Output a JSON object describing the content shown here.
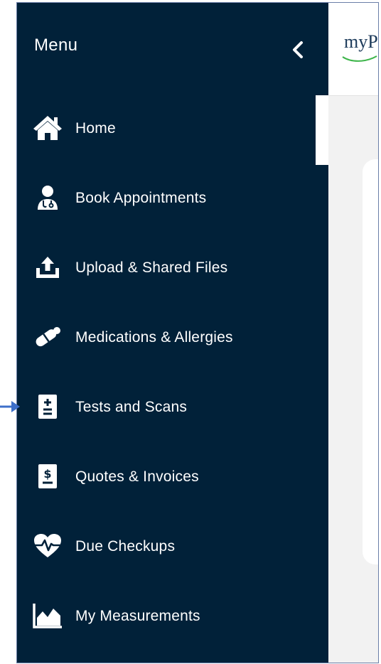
{
  "sidebar": {
    "title": "Menu",
    "collapse_icon": "chevron-left-icon",
    "items": [
      {
        "label": "Home",
        "icon": "home-icon"
      },
      {
        "label": "Book Appointments",
        "icon": "doctor-icon"
      },
      {
        "label": "Upload & Shared Files",
        "icon": "upload-icon"
      },
      {
        "label": "Medications & Allergies",
        "icon": "pill-icon"
      },
      {
        "label": "Tests and Scans",
        "icon": "test-report-icon"
      },
      {
        "label": "Quotes & Invoices",
        "icon": "invoice-icon"
      },
      {
        "label": "Due Checkups",
        "icon": "heartbeat-icon"
      },
      {
        "label": "My Measurements",
        "icon": "area-chart-icon"
      }
    ]
  },
  "header": {
    "brand": "myP"
  },
  "colors": {
    "sidebar_bg": "#012139",
    "text": "#ffffff",
    "brand_text": "#1c3a5a",
    "brand_accent": "#3db54a",
    "annotation_arrow": "#3d6fc9"
  }
}
